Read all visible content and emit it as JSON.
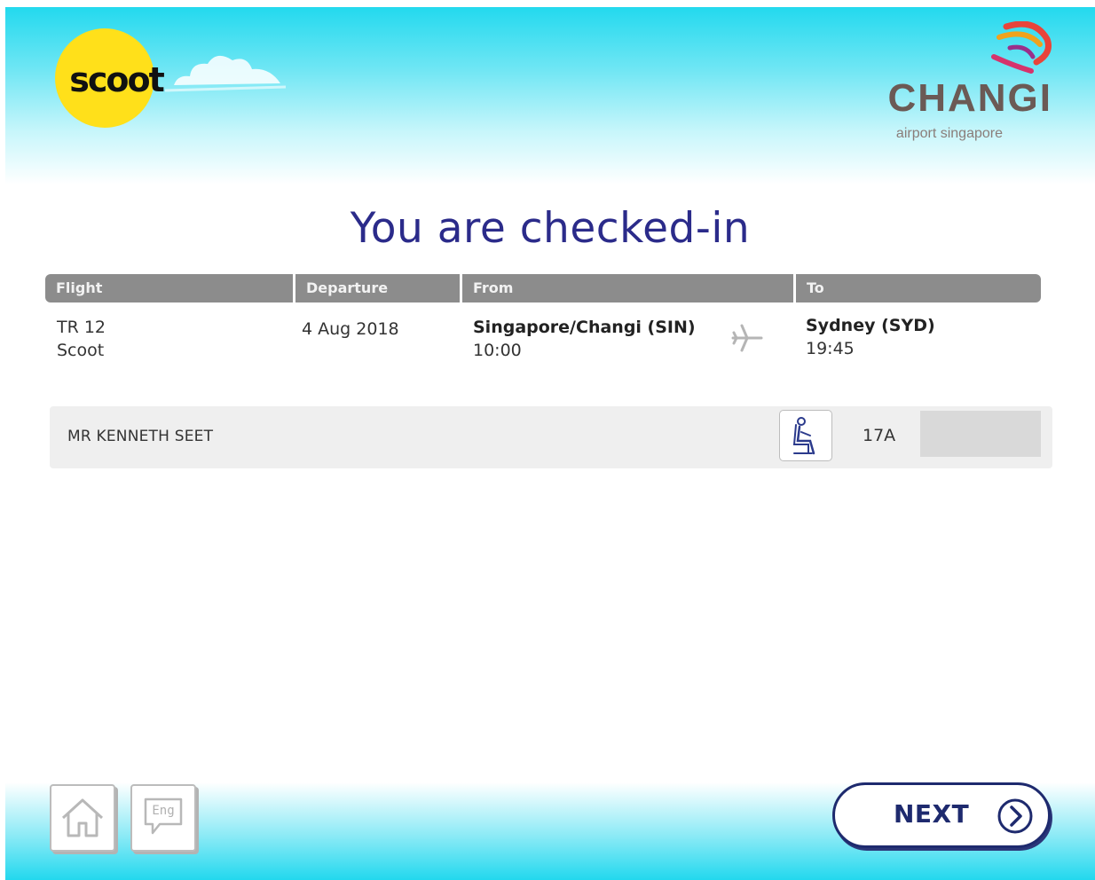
{
  "header": {
    "airline_logo_text": "scoot",
    "airport_logo_name": "CHANGI",
    "airport_logo_sub": "airport singapore"
  },
  "title": "You are checked-in",
  "flight_table": {
    "headers": [
      "Flight",
      "Departure",
      "From",
      "To"
    ],
    "flight_number": "TR 12",
    "airline": "Scoot",
    "departure_date": "4 Aug 2018",
    "from_airport": "Singapore/Changi (SIN)",
    "from_time": "10:00",
    "to_airport": "Sydney (SYD)",
    "to_time": "19:45"
  },
  "passenger": {
    "name": "MR KENNETH SEET",
    "seat": "17A"
  },
  "footer": {
    "language_label": "Eng",
    "next_label": "NEXT"
  },
  "icons": {
    "home": "home-icon",
    "language": "speech-bubble-icon",
    "seat": "seat-icon",
    "plane": "plane-icon",
    "next": "chevron-right-circle-icon"
  },
  "colors": {
    "title": "#2b2b8a",
    "scoot_yellow": "#ffe01a",
    "header_bar": "#8c8c8c",
    "next_border": "#1e2a6e",
    "sky": "#23d9ee"
  }
}
